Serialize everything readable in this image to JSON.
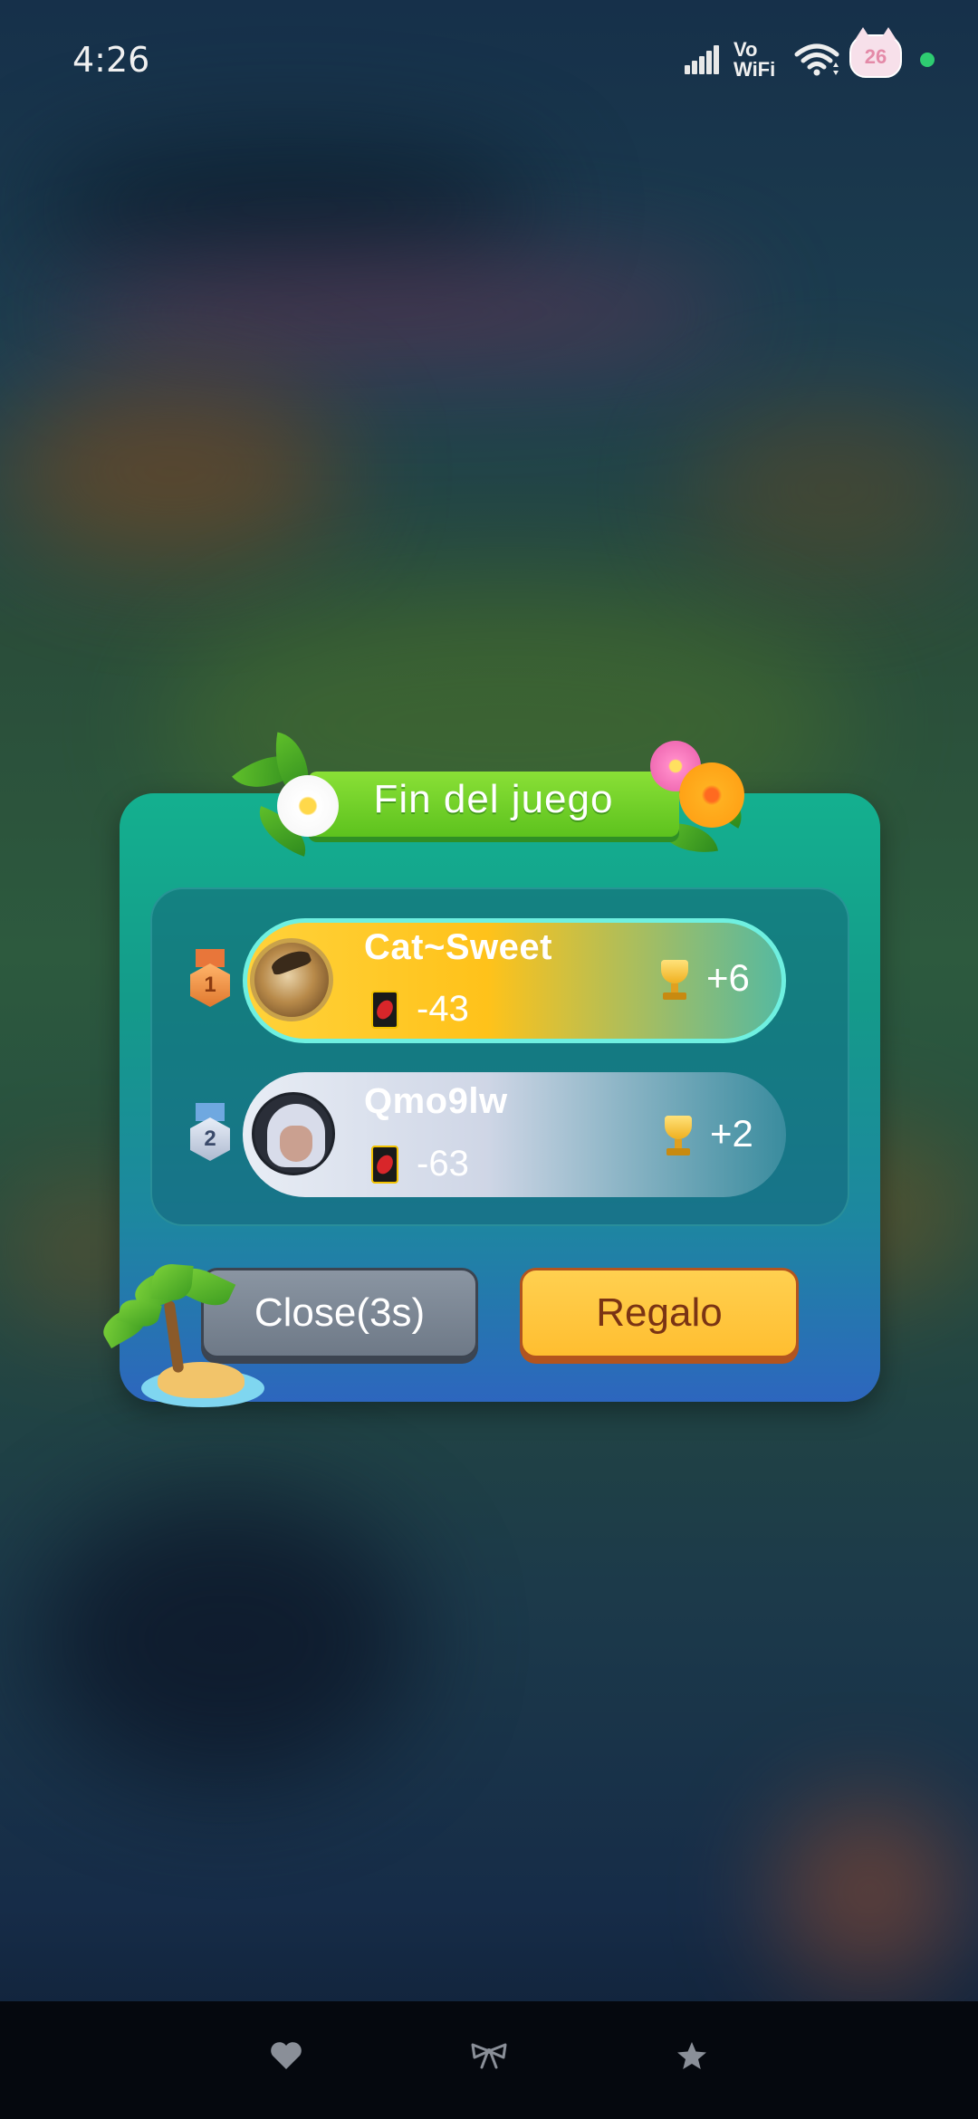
{
  "status_bar": {
    "time": "4:26",
    "network_label_top": "Vo",
    "network_label_bottom": "WiFi",
    "badge_number": "26"
  },
  "dialog": {
    "title": "Fin del juego",
    "players": [
      {
        "rank": "1",
        "name": "Cat~Sweet",
        "card_score": "-43",
        "trophy_delta": "+6"
      },
      {
        "rank": "2",
        "name": "Qmo9lw",
        "card_score": "-63",
        "trophy_delta": "+2"
      }
    ],
    "close_label": "Close(3s)",
    "gift_label": "Regalo"
  },
  "nav": {
    "heart": "heart-icon",
    "bow": "bow-icon",
    "star": "star-icon"
  },
  "colors": {
    "dialog_top": "#14b08f",
    "dialog_bottom": "#2d66be",
    "banner": "#6fd12a",
    "gift_button": "#ffc83a",
    "close_button": "#7b8694"
  }
}
